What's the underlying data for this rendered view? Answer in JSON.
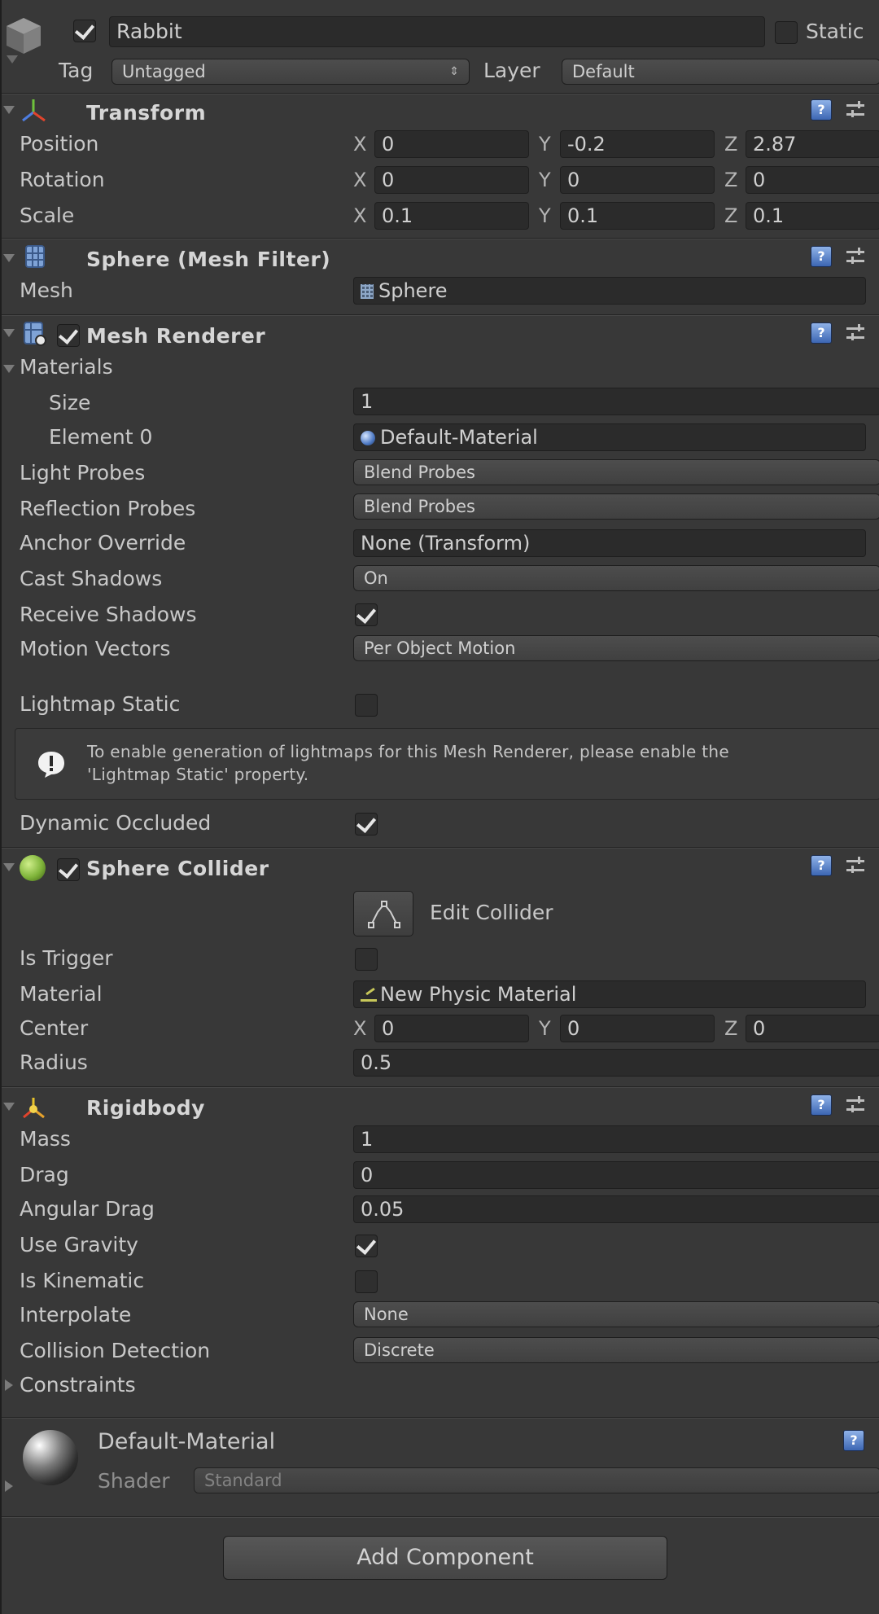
{
  "header": {
    "name": "Rabbit",
    "static_label": "Static",
    "tag_label": "Tag",
    "tag_value": "Untagged",
    "layer_label": "Layer",
    "layer_value": "Default"
  },
  "transform": {
    "title": "Transform",
    "position_label": "Position",
    "rotation_label": "Rotation",
    "scale_label": "Scale",
    "axes": [
      "X",
      "Y",
      "Z"
    ],
    "position": [
      "0",
      "-0.2",
      "2.87"
    ],
    "rotation": [
      "0",
      "0",
      "0"
    ],
    "scale": [
      "0.1",
      "0.1",
      "0.1"
    ]
  },
  "mesh_filter": {
    "title": "Sphere (Mesh Filter)",
    "mesh_label": "Mesh",
    "mesh_value": "Sphere"
  },
  "mesh_renderer": {
    "title": "Mesh Renderer",
    "materials_label": "Materials",
    "size_label": "Size",
    "size_value": "1",
    "element0_label": "Element 0",
    "element0_value": "Default-Material",
    "light_probes_label": "Light Probes",
    "light_probes_value": "Blend Probes",
    "reflection_probes_label": "Reflection Probes",
    "reflection_probes_value": "Blend Probes",
    "anchor_override_label": "Anchor Override",
    "anchor_override_value": "None (Transform)",
    "cast_shadows_label": "Cast Shadows",
    "cast_shadows_value": "On",
    "receive_shadows_label": "Receive Shadows",
    "motion_vectors_label": "Motion Vectors",
    "motion_vectors_value": "Per Object Motion",
    "lightmap_static_label": "Lightmap Static",
    "info_line1": "To enable generation of lightmaps for this Mesh Renderer, please enable the",
    "info_line2": "'Lightmap Static' property.",
    "dynamic_occluded_label": "Dynamic Occluded"
  },
  "sphere_collider": {
    "title": "Sphere Collider",
    "edit_collider_label": "Edit Collider",
    "is_trigger_label": "Is Trigger",
    "material_label": "Material",
    "material_value": "New Physic Material",
    "center_label": "Center",
    "center": [
      "0",
      "0",
      "0"
    ],
    "radius_label": "Radius",
    "radius_value": "0.5"
  },
  "rigidbody": {
    "title": "Rigidbody",
    "mass_label": "Mass",
    "mass_value": "1",
    "drag_label": "Drag",
    "drag_value": "0",
    "angular_drag_label": "Angular Drag",
    "angular_drag_value": "0.05",
    "use_gravity_label": "Use Gravity",
    "is_kinematic_label": "Is Kinematic",
    "interpolate_label": "Interpolate",
    "interpolate_value": "None",
    "collision_detection_label": "Collision Detection",
    "collision_detection_value": "Discrete",
    "constraints_label": "Constraints"
  },
  "material_preview": {
    "name": "Default-Material",
    "shader_label": "Shader",
    "shader_value": "Standard"
  },
  "add_component_label": "Add Component",
  "colors": {
    "background": "#383838",
    "field": "#2b2b2b",
    "help_icon": "#5b86d0",
    "collider_icon": "#7fb43a"
  }
}
